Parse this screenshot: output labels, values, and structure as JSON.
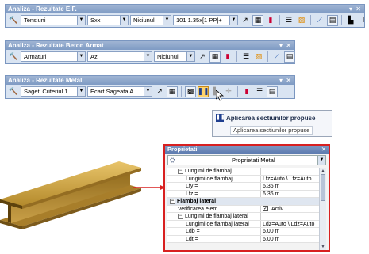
{
  "toolbars": [
    {
      "title": "Analiza - Rezultate E.F.",
      "selects": [
        "Tensiuni",
        "Sxx",
        "Niciunul",
        "101 1.35x[1 PP]+"
      ]
    },
    {
      "title": "Analiza - Rezultate Beton Armat",
      "selects": [
        "Armaturi",
        "Az",
        "Niciunul"
      ]
    },
    {
      "title": "Analiza - Rezultate Metal",
      "selects": [
        "Sageti Criteriul 1",
        "Ecart Sageata A"
      ]
    }
  ],
  "tooltip": {
    "title": "Aplicarea sectiunilor propuse",
    "subtitle": "Aplicarea sectiunilor propuse"
  },
  "properties": {
    "title": "Proprietati",
    "combo_value": "Proprietati Metal",
    "rows": [
      {
        "key": "Lungimi de flambaj",
        "value": "",
        "level": 1,
        "type": "group"
      },
      {
        "key": "Lungimi de flambaj",
        "value": "Lfz=Auto \\ Lfz=Auto",
        "level": 2,
        "type": "prop"
      },
      {
        "key": "Lfy =",
        "value": "6.36 m",
        "level": 2,
        "type": "prop"
      },
      {
        "key": "Lfz =",
        "value": "6.36 m",
        "level": 2,
        "type": "prop"
      },
      {
        "key": "Flambaj lateral",
        "value": "",
        "level": 0,
        "type": "cat"
      },
      {
        "key": "Verificarea elem.",
        "value": "Activ",
        "level": 1,
        "type": "check"
      },
      {
        "key": "Lungimi de flambaj lateral",
        "value": "",
        "level": 1,
        "type": "group"
      },
      {
        "key": "Lungimi de flambaj lateral",
        "value": "Ldz=Auto \\ Ldz=Auto",
        "level": 2,
        "type": "prop"
      },
      {
        "key": "Ldb =",
        "value": "6.00 m",
        "level": 2,
        "type": "prop"
      },
      {
        "key": "Ldt =",
        "value": "6.00 m",
        "level": 2,
        "type": "prop"
      }
    ]
  },
  "colors": {
    "highlight_border": "#d82020",
    "title_bar": "#7e9bc4",
    "beam": "#b9902f"
  }
}
